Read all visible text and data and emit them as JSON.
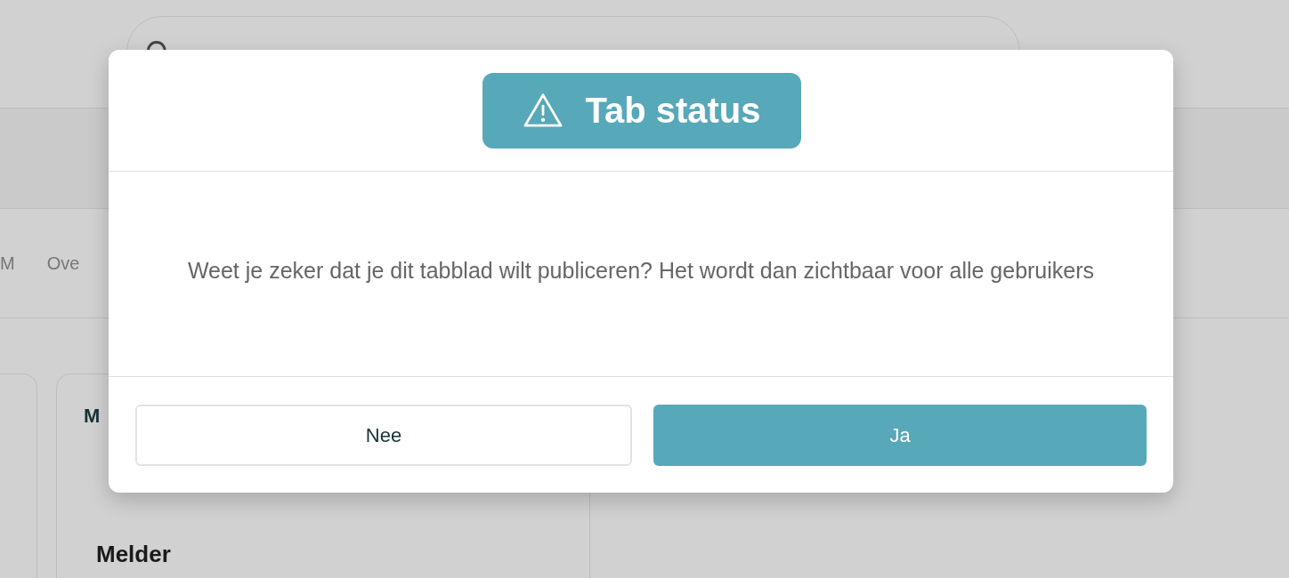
{
  "tabs": [
    {
      "label": "M"
    },
    {
      "label": "Ove"
    }
  ],
  "cards": [
    {
      "title": "M",
      "section": "Melder"
    }
  ],
  "dialog": {
    "title": "Tab status",
    "message": "Weet je zeker dat je dit tabblad wilt publiceren? Het wordt dan zichtbaar voor alle gebruikers",
    "buttons": [
      {
        "label": "Nee",
        "kind": "secondary"
      },
      {
        "label": "Ja",
        "kind": "primary"
      }
    ]
  }
}
